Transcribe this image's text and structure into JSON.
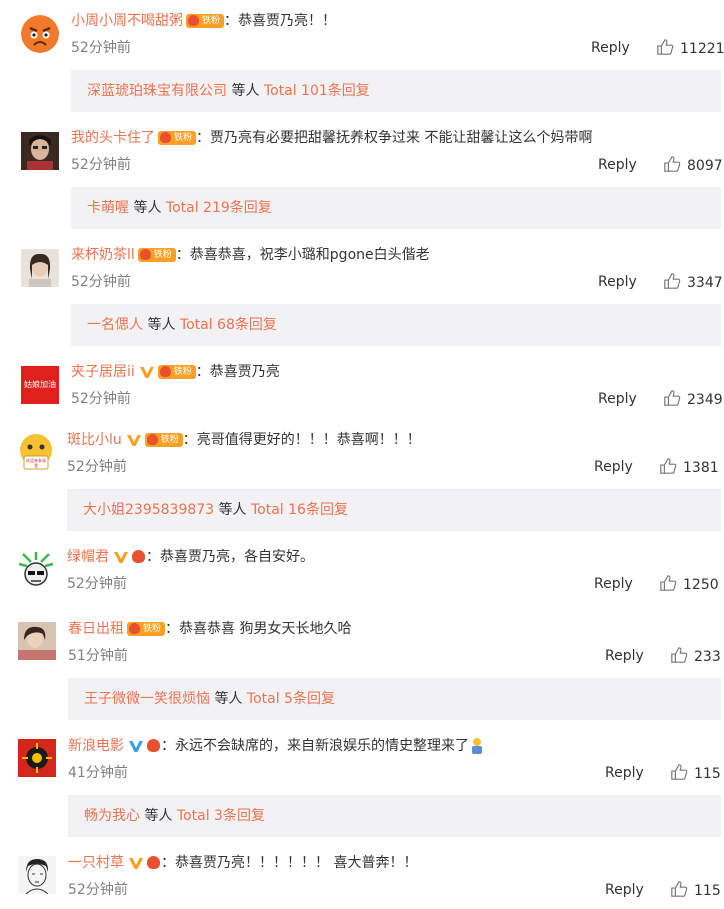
{
  "comments": [
    {
      "username": "小周小周不喝甜粥",
      "badge": "铁粉",
      "text": "恭喜贾乃亮！！",
      "time": "52分钟前",
      "reply": "Reply",
      "likes": "11221",
      "thread": {
        "user": "深蓝琥珀珠宝有限公司",
        "middle": " 等人 ",
        "total": "Total 101条回复"
      }
    },
    {
      "username": "我的头卡住了",
      "badge": "铁粉",
      "text": "贾乃亮有必要把甜馨抚养权争过来 不能让甜馨让这么个妈带啊",
      "time": "52分钟前",
      "reply": "Reply",
      "likes": "8097",
      "thread": {
        "user": "卡萌喔",
        "middle": " 等人 ",
        "total": "Total 219条回复"
      }
    },
    {
      "username": "来杯奶茶ll",
      "badge": "铁粉",
      "text": "恭喜恭喜，祝李小璐和pgone白头偕老",
      "time": "52分钟前",
      "reply": "Reply",
      "likes": "3347",
      "thread": {
        "user": "一名偲人",
        "middle": " 等人 ",
        "total": "Total 68条回复"
      }
    },
    {
      "username": "夹子居居ii",
      "badge": "铁粉",
      "text": "恭喜贾乃亮",
      "time": "52分钟前",
      "reply": "Reply",
      "likes": "2349",
      "avatar_text": "姑娘加油"
    },
    {
      "username": "斑比小lu",
      "badge": "铁粉",
      "text": "亮哥值得更好的！！！恭喜啊！！！",
      "time": "52分钟前",
      "reply": "Reply",
      "likes": "1381",
      "avatar_text": "欢迎来参观我",
      "thread": {
        "user": "大小姐2395839873",
        "middle": " 等人 ",
        "total": "Total 16条回复"
      }
    },
    {
      "username": "绿帽君",
      "text": "恭喜贾乃亮，各自安好。",
      "time": "52分钟前",
      "reply": "Reply",
      "likes": "1250"
    },
    {
      "username": "春日出租",
      "badge": "铁粉",
      "text": "恭喜恭喜 狗男女天长地久哈",
      "time": "51分钟前",
      "reply": "Reply",
      "likes": "233",
      "thread": {
        "user": "王子微微一笑很烦恼",
        "middle": " 等人 ",
        "total": "Total 5条回复"
      }
    },
    {
      "username": "新浪电影",
      "text": "永远不会缺席的，来自新浪娱乐的情史整理来了",
      "time": "41分钟前",
      "reply": "Reply",
      "likes": "115",
      "thread": {
        "user": "畅为我心",
        "middle": " 等人 ",
        "total": "Total 3条回复"
      }
    },
    {
      "username": "一只村草",
      "text": "恭喜贾乃亮！！！！！！ 喜大普奔！！",
      "time": "52分钟前",
      "reply": "Reply",
      "likes": "115"
    }
  ],
  "colors": {
    "link": "#eb7350",
    "time": "#808080",
    "thread_bg": "#f2f2f5",
    "vip": "#f7a023"
  },
  "icons": {
    "like": "thumbs-up-icon",
    "vip": "vip-v-icon",
    "fan": "fan-badge-icon"
  }
}
